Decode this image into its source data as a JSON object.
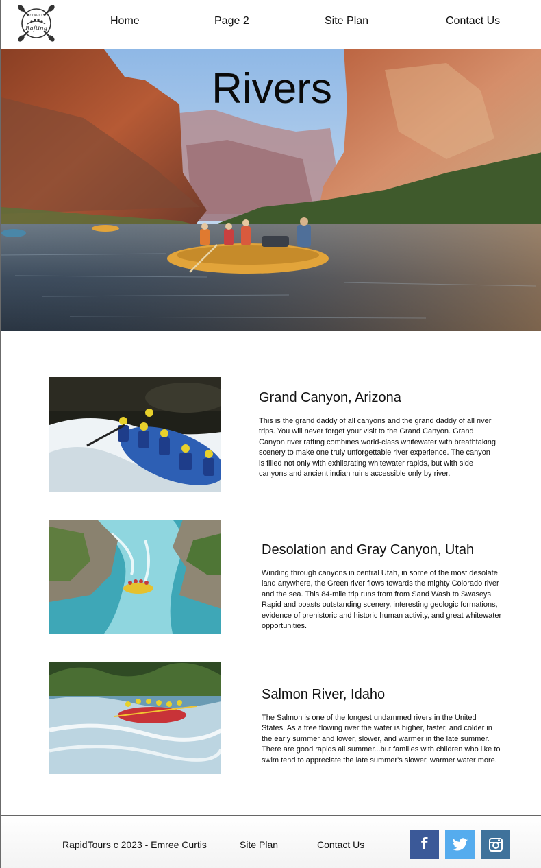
{
  "nav": {
    "home": "Home",
    "page2": "Page 2",
    "site_plan": "Site Plan",
    "contact": "Contact Us"
  },
  "logo": {
    "top_text": "ROCKHILLS",
    "main_text": "Rafting"
  },
  "hero": {
    "title": "Rivers"
  },
  "rivers": [
    {
      "title": "Grand Canyon, Arizona",
      "description": "This is the grand daddy of all canyons and the grand daddy of all river trips. You will never forget your visit to the Grand Canyon. Grand Canyon river rafting combines world-class whitewater with breathtaking scenery to make one truly unforgettable river experience. The canyon is filled not only with exhilarating whitewater rapids, but with side canyons and ancient indian ruins accessible only by river."
    },
    {
      "title": "Desolation and Gray Canyon, Utah",
      "description": "Winding through canyons in central Utah, in some of the most desolate land anywhere, the Green river flows towards the mighty Colorado river and the sea. This 84-mile trip runs from from Sand Wash to Swaseys Rapid and boasts outstanding scenery, interesting geologic formations, evidence of prehistoric and historic human activity, and great whitewater opportunities."
    },
    {
      "title": "Salmon River, Idaho",
      "description": "The Salmon is one of the longest undammed rivers in the United States. As a free flowing river the water is higher, faster, and colder in the early summer and lower, slower, and warmer in the late summer. There are good rapids all summer...but families with children who like to swim tend to appreciate the late summer's slower, warmer water more."
    }
  ],
  "footer": {
    "copyright": "RapidTours c 2023 - Emree Curtis",
    "site_plan": "Site Plan",
    "contact": "Contact Us",
    "social": [
      {
        "name": "facebook-icon",
        "glyph": "f",
        "color": "#3b5998"
      },
      {
        "name": "twitter-icon",
        "color": "#55acee"
      },
      {
        "name": "instagram-icon",
        "color": "#3f729b"
      }
    ]
  }
}
